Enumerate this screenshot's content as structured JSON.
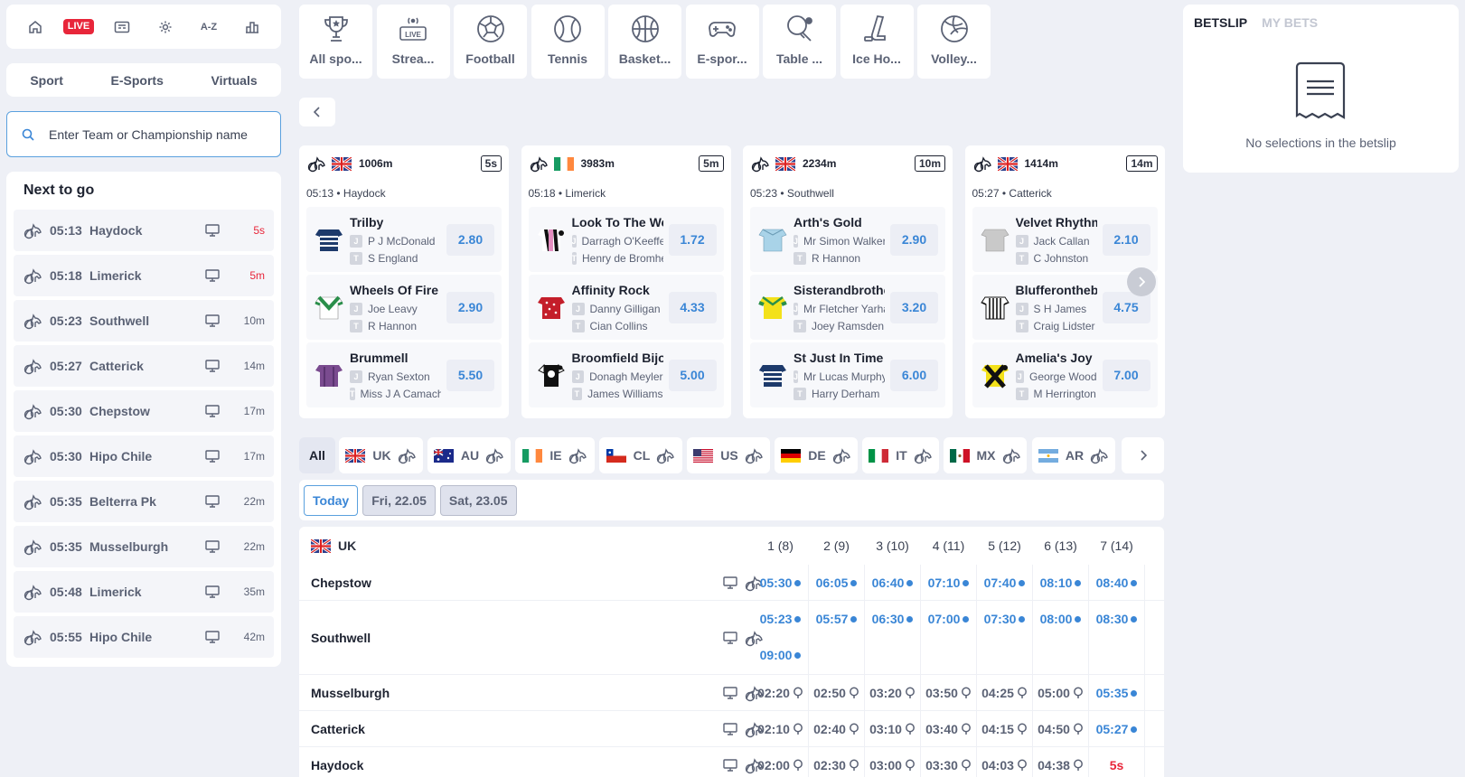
{
  "top_icons": {
    "live": "LIVE",
    "az": "A-Z"
  },
  "sport_tabs": [
    "Sport",
    "E-Sports",
    "Virtuals"
  ],
  "search": {
    "placeholder": "Enter Team or Championship name"
  },
  "next_to_go": {
    "title": "Next to go",
    "rows": [
      {
        "time": "05:13",
        "track": "Haydock",
        "countdown": "5s",
        "urgent": true
      },
      {
        "time": "05:18",
        "track": "Limerick",
        "countdown": "5m",
        "urgent": true
      },
      {
        "time": "05:23",
        "track": "Southwell",
        "countdown": "10m",
        "urgent": false
      },
      {
        "time": "05:27",
        "track": "Catterick",
        "countdown": "14m",
        "urgent": false
      },
      {
        "time": "05:30",
        "track": "Chepstow",
        "countdown": "17m",
        "urgent": false
      },
      {
        "time": "05:30",
        "track": "Hipo Chile",
        "countdown": "17m",
        "urgent": false
      },
      {
        "time": "05:35",
        "track": "Belterra Pk",
        "countdown": "22m",
        "urgent": false
      },
      {
        "time": "05:35",
        "track": "Musselburgh",
        "countdown": "22m",
        "urgent": false
      },
      {
        "time": "05:48",
        "track": "Limerick",
        "countdown": "35m",
        "urgent": false
      },
      {
        "time": "05:55",
        "track": "Hipo Chile",
        "countdown": "42m",
        "urgent": false
      }
    ]
  },
  "sports_nav": [
    {
      "label": "All spo...",
      "icon": "trophy-icon"
    },
    {
      "label": "Strea...",
      "icon": "live-stream-icon"
    },
    {
      "label": "Football",
      "icon": "football-icon"
    },
    {
      "label": "Tennis",
      "icon": "tennis-icon"
    },
    {
      "label": "Basket...",
      "icon": "basketball-icon"
    },
    {
      "label": "E-spor...",
      "icon": "gamepad-icon"
    },
    {
      "label": "Table ...",
      "icon": "table-tennis-icon"
    },
    {
      "label": "Ice Ho...",
      "icon": "ice-hockey-icon"
    },
    {
      "label": "Volley...",
      "icon": "volleyball-icon"
    }
  ],
  "race_cards": [
    {
      "flag": "uk",
      "distance": "1006m",
      "timer": "5s",
      "subtitle": "05:13 • Haydock",
      "runners": [
        {
          "name": "Trilby",
          "jockey": "P J McDonald",
          "trainer": "S England",
          "odds": "2.80",
          "silk": "navy-stripes"
        },
        {
          "name": "Wheels Of Fire",
          "jockey": "Joe Leavy",
          "trainer": "R Hannon",
          "odds": "2.90",
          "silk": "green-chevron"
        },
        {
          "name": "Brummell",
          "jockey": "Ryan Sexton",
          "trainer": "Miss J A Camacho",
          "odds": "5.50",
          "silk": "purple"
        }
      ]
    },
    {
      "flag": "ie",
      "distance": "3983m",
      "timer": "5m",
      "subtitle": "05:18 • Limerick",
      "runners": [
        {
          "name": "Look To The West",
          "jockey": "Darragh O'Keeffe",
          "trainer": "Henry de Bromhead",
          "odds": "1.72",
          "silk": "black-pink"
        },
        {
          "name": "Affinity Rock",
          "jockey": "Danny Gilligan",
          "trainer": "Cian Collins",
          "odds": "4.33",
          "silk": "red-spots"
        },
        {
          "name": "Broomfield Bijou",
          "jockey": "Donagh Meyler",
          "trainer": "James Williams",
          "odds": "5.00",
          "silk": "black-white-sleeves"
        }
      ]
    },
    {
      "flag": "uk",
      "distance": "2234m",
      "timer": "10m",
      "subtitle": "05:23 • Southwell",
      "runners": [
        {
          "name": "Arth's Gold",
          "jockey": "Mr Simon Walker",
          "trainer": "R Hannon",
          "odds": "2.90",
          "silk": "light-blue"
        },
        {
          "name": "Sisterandbrother",
          "jockey": "Mr Fletcher Yarham",
          "trainer": "Joey Ramsden",
          "odds": "3.20",
          "silk": "yellow-green"
        },
        {
          "name": "St Just In Time",
          "jockey": "Mr Lucas Murphy",
          "trainer": "Harry Derham",
          "odds": "6.00",
          "silk": "navy-stripes"
        }
      ]
    },
    {
      "flag": "uk",
      "distance": "1414m",
      "timer": "14m",
      "subtitle": "05:27 • Catterick",
      "runners": [
        {
          "name": "Velvet Rhythm",
          "jockey": "Jack Callan",
          "trainer": "C Johnston",
          "odds": "2.10",
          "silk": "grey"
        },
        {
          "name": "Blufferonthebus",
          "jockey": "S H James",
          "trainer": "Craig Lidster",
          "odds": "4.75",
          "silk": "white-black-stripes"
        },
        {
          "name": "Amelia's Joy",
          "jockey": "George Wood",
          "trainer": "M Herrington",
          "odds": "7.00",
          "silk": "yellow-black-cross"
        }
      ]
    }
  ],
  "country_tabs": [
    {
      "label": "All",
      "active": true
    },
    {
      "label": "UK",
      "flag": "uk"
    },
    {
      "label": "AU",
      "flag": "au"
    },
    {
      "label": "IE",
      "flag": "ie"
    },
    {
      "label": "CL",
      "flag": "cl"
    },
    {
      "label": "US",
      "flag": "us"
    },
    {
      "label": "DE",
      "flag": "de"
    },
    {
      "label": "IT",
      "flag": "it"
    },
    {
      "label": "MX",
      "flag": "mx"
    },
    {
      "label": "AR",
      "flag": "ar"
    }
  ],
  "date_tabs": [
    {
      "label": "Today",
      "active": true
    },
    {
      "label": "Fri, 22.05",
      "active": false
    },
    {
      "label": "Sat, 23.05",
      "active": false
    }
  ],
  "schedule": {
    "region": "UK",
    "columns": [
      "1 (8)",
      "2 (9)",
      "3 (10)",
      "4 (11)",
      "5 (12)",
      "6 (13)",
      "7 (14)"
    ],
    "tracks": [
      {
        "name": "Chepstow",
        "slots": [
          [
            {
              "t": "05:30",
              "s": "open"
            },
            {
              "t": "06:05",
              "s": "open"
            },
            {
              "t": "06:40",
              "s": "open"
            },
            {
              "t": "07:10",
              "s": "open"
            },
            {
              "t": "07:40",
              "s": "open"
            },
            {
              "t": "08:10",
              "s": "open"
            },
            {
              "t": "08:40",
              "s": "open"
            }
          ]
        ]
      },
      {
        "name": "Southwell",
        "slots": [
          [
            {
              "t": "05:23",
              "s": "open"
            },
            {
              "t": "05:57",
              "s": "open"
            },
            {
              "t": "06:30",
              "s": "open"
            },
            {
              "t": "07:00",
              "s": "open"
            },
            {
              "t": "07:30",
              "s": "open"
            },
            {
              "t": "08:00",
              "s": "open"
            },
            {
              "t": "08:30",
              "s": "open"
            }
          ],
          [
            {
              "t": "09:00",
              "s": "open"
            }
          ]
        ]
      },
      {
        "name": "Musselburgh",
        "slots": [
          [
            {
              "t": "02:20",
              "s": "result"
            },
            {
              "t": "02:50",
              "s": "result"
            },
            {
              "t": "03:20",
              "s": "result"
            },
            {
              "t": "03:50",
              "s": "result"
            },
            {
              "t": "04:25",
              "s": "result"
            },
            {
              "t": "05:00",
              "s": "result"
            },
            {
              "t": "05:35",
              "s": "open"
            }
          ]
        ]
      },
      {
        "name": "Catterick",
        "slots": [
          [
            {
              "t": "02:10",
              "s": "result"
            },
            {
              "t": "02:40",
              "s": "result"
            },
            {
              "t": "03:10",
              "s": "result"
            },
            {
              "t": "03:40",
              "s": "result"
            },
            {
              "t": "04:15",
              "s": "result"
            },
            {
              "t": "04:50",
              "s": "result"
            },
            {
              "t": "05:27",
              "s": "open"
            }
          ]
        ]
      },
      {
        "name": "Haydock",
        "slots": [
          [
            {
              "t": "02:00",
              "s": "result"
            },
            {
              "t": "02:30",
              "s": "result"
            },
            {
              "t": "03:00",
              "s": "result"
            },
            {
              "t": "03:30",
              "s": "result"
            },
            {
              "t": "04:03",
              "s": "result"
            },
            {
              "t": "04:38",
              "s": "result"
            },
            {
              "t": "5s",
              "s": "urgent"
            }
          ]
        ]
      }
    ]
  },
  "betslip": {
    "tab_active": "BETSLIP",
    "tab_inactive": "MY BETS",
    "empty_message": "No selections in the betslip"
  },
  "colors": {
    "accent": "#3a86d6",
    "live": "#e8263a",
    "background": "#eef0f6"
  }
}
